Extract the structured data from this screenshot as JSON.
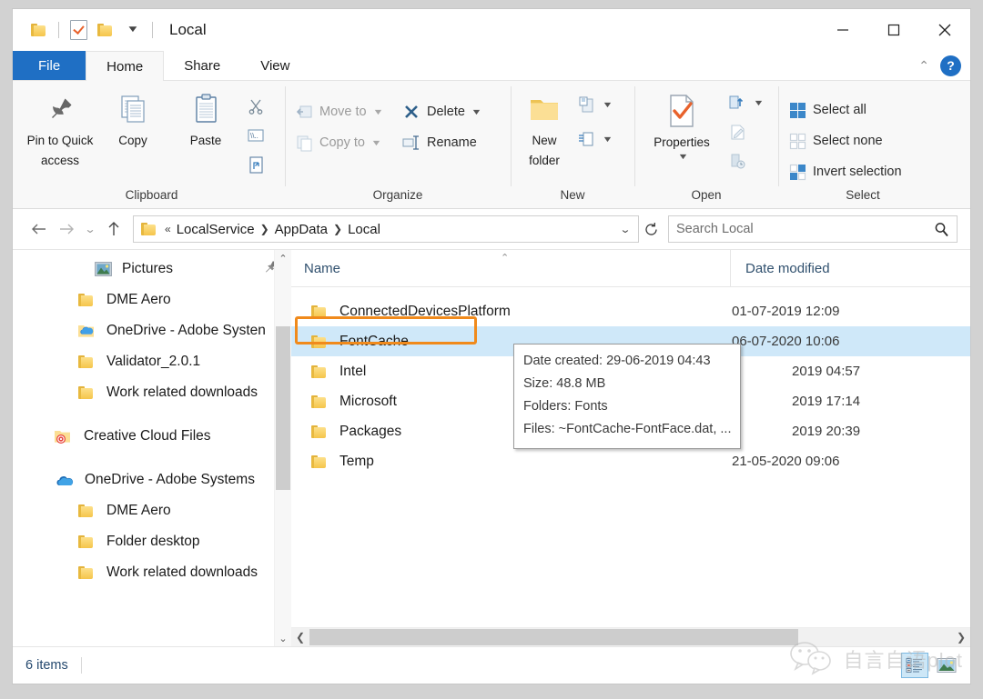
{
  "window": {
    "title": "Local",
    "quick_access": {
      "folder_icon": "folder-icon",
      "properties_icon": "properties-check-icon",
      "new_folder_icon": "new-folder-icon",
      "dropdown_icon": "chevron-down-icon"
    },
    "controls": {
      "minimize": "minimize-icon",
      "maximize": "maximize-icon",
      "close": "close-icon"
    }
  },
  "ribbon": {
    "tabs": [
      {
        "label": "File",
        "state": "file"
      },
      {
        "label": "Home",
        "state": "active"
      },
      {
        "label": "Share",
        "state": "normal"
      },
      {
        "label": "View",
        "state": "normal"
      }
    ],
    "collapse_icon": "chevron-up-icon",
    "help_label": "?",
    "groups": [
      {
        "name": "Clipboard",
        "label": "Clipboard",
        "big_buttons": [
          {
            "label": "Pin to Quick\naccess",
            "line1": "Pin to Quick",
            "line2": "access",
            "icon": "pin-icon"
          },
          {
            "label": "Copy",
            "line1": "Copy",
            "line2": "",
            "icon": "copy-icon"
          },
          {
            "label": "Paste",
            "line1": "Paste",
            "line2": "",
            "icon": "paste-icon"
          }
        ],
        "small_buttons": [
          {
            "label": "",
            "icon": "cut-scissors-icon",
            "disabled": false
          },
          {
            "label": "",
            "icon": "copy-path-icon",
            "disabled": false
          },
          {
            "label": "",
            "icon": "paste-shortcut-icon",
            "disabled": false
          }
        ]
      },
      {
        "name": "Organize",
        "label": "Organize",
        "small_buttons": [
          {
            "label": "Move to",
            "icon": "move-to-icon",
            "disabled": true,
            "has_caret": true
          },
          {
            "label": "Delete",
            "icon": "delete-x-icon",
            "disabled": false,
            "has_caret": true
          },
          {
            "label": "Copy to",
            "icon": "copy-to-icon",
            "disabled": true,
            "has_caret": true
          },
          {
            "label": "Rename",
            "icon": "rename-icon",
            "disabled": false,
            "has_caret": false
          }
        ]
      },
      {
        "name": "New",
        "label": "New",
        "big_buttons": [
          {
            "line1": "New",
            "line2": "folder",
            "icon": "new-folder-icon"
          }
        ],
        "small_buttons": [
          {
            "label": "",
            "icon": "new-item-icon",
            "disabled": false,
            "has_caret": true
          },
          {
            "label": "",
            "icon": "easy-access-icon",
            "disabled": false,
            "has_caret": true
          }
        ]
      },
      {
        "name": "Open",
        "label": "Open",
        "big_buttons": [
          {
            "line1": "Properties",
            "line2": "",
            "icon": "properties-check-icon",
            "has_caret": true
          }
        ],
        "small_buttons": [
          {
            "label": "",
            "icon": "open-icon",
            "disabled": false,
            "has_caret": true
          },
          {
            "label": "",
            "icon": "edit-icon",
            "disabled": true,
            "has_caret": false
          },
          {
            "label": "",
            "icon": "history-icon",
            "disabled": true,
            "has_caret": false
          }
        ]
      },
      {
        "name": "Select",
        "label": "Select",
        "small_buttons": [
          {
            "label": "Select all",
            "icon": "select-all-icon",
            "disabled": false
          },
          {
            "label": "Select none",
            "icon": "select-none-icon",
            "disabled": false
          },
          {
            "label": "Invert selection",
            "icon": "invert-selection-icon",
            "disabled": false
          }
        ]
      }
    ]
  },
  "addressbar": {
    "back_icon": "arrow-left-icon",
    "forward_icon": "arrow-right-icon",
    "recent_icon": "chevron-down-icon",
    "up_icon": "arrow-up-icon",
    "folder_icon": "folder-icon",
    "overflow": "«",
    "breadcrumbs": [
      "LocalService",
      "AppData",
      "Local"
    ],
    "dropdown_icon": "chevron-down-icon",
    "refresh_icon": "refresh-icon"
  },
  "search": {
    "placeholder": "Search Local",
    "icon": "search-icon"
  },
  "navpane": {
    "items": [
      {
        "label": "Pictures",
        "icon": "pictures-icon",
        "indent": 1,
        "pinned": true,
        "pin_icon": "pin-icon"
      },
      {
        "label": "DME Aero",
        "icon": "folder-icon",
        "indent": 1
      },
      {
        "label": "OneDrive - Adobe Systen",
        "icon": "onedrive-folder-icon",
        "indent": 1
      },
      {
        "label": "Validator_2.0.1",
        "icon": "folder-icon",
        "indent": 1
      },
      {
        "label": "Work related downloads",
        "icon": "folder-icon",
        "indent": 1
      },
      {
        "label": "Creative Cloud Files",
        "icon": "creative-cloud-icon",
        "indent": 0,
        "spacer_before": true
      },
      {
        "label": "OneDrive - Adobe Systems",
        "icon": "onedrive-cloud-icon",
        "indent": 0,
        "spacer_before": true
      },
      {
        "label": "DME Aero",
        "icon": "folder-icon",
        "indent": 1
      },
      {
        "label": "Folder desktop",
        "icon": "folder-icon",
        "indent": 1
      },
      {
        "label": "Work related downloads",
        "icon": "folder-icon",
        "indent": 1
      }
    ],
    "scroll_up_icon": "chevron-up-icon",
    "scroll_down_icon": "chevron-down-icon"
  },
  "filelist": {
    "columns": [
      {
        "key": "name",
        "label": "Name",
        "sorted": true,
        "sort_icon": "sort-ascending-icon"
      },
      {
        "key": "date",
        "label": "Date modified"
      }
    ],
    "rows": [
      {
        "name": "ConnectedDevicesPlatform",
        "date": "01-07-2019 12:09",
        "icon": "folder-icon",
        "selected": false
      },
      {
        "name": "FontCache",
        "date": "06-07-2020 10:06",
        "icon": "folder-icon",
        "selected": true,
        "annotated": true
      },
      {
        "name": "Intel",
        "date": "2019 04:57",
        "icon": "folder-icon",
        "selected": false
      },
      {
        "name": "Microsoft",
        "date": "2019 17:14",
        "icon": "folder-icon",
        "selected": false
      },
      {
        "name": "Packages",
        "date": "2019 20:39",
        "icon": "folder-icon",
        "selected": false
      },
      {
        "name": "Temp",
        "date": "21-05-2020 09:06",
        "icon": "folder-icon",
        "selected": false
      }
    ]
  },
  "tooltip": {
    "lines": [
      "Date created: 29-06-2019 04:43",
      "Size: 48.8 MB",
      "Folders: Fonts",
      "Files: ~FontCache-FontFace.dat, ..."
    ]
  },
  "statusbar": {
    "item_count": "6 items",
    "views": [
      {
        "name": "details-view-button",
        "icon": "details-view-icon",
        "active": true
      },
      {
        "name": "large-icons-view-button",
        "icon": "large-icons-view-icon",
        "active": false
      }
    ]
  },
  "scrollbars": {
    "horizontal_left_icon": "chevron-left-icon",
    "horizontal_right_icon": "chevron-right-icon"
  },
  "watermark": {
    "text": "自言自语plot",
    "icon": "wechat-icon"
  },
  "colors": {
    "accent_blue": "#1f6fc4",
    "selection": "#cfe8f9",
    "annotation_orange": "#f08a1c",
    "folder_yellow": "#f5c54b",
    "header_text": "#30506e"
  }
}
